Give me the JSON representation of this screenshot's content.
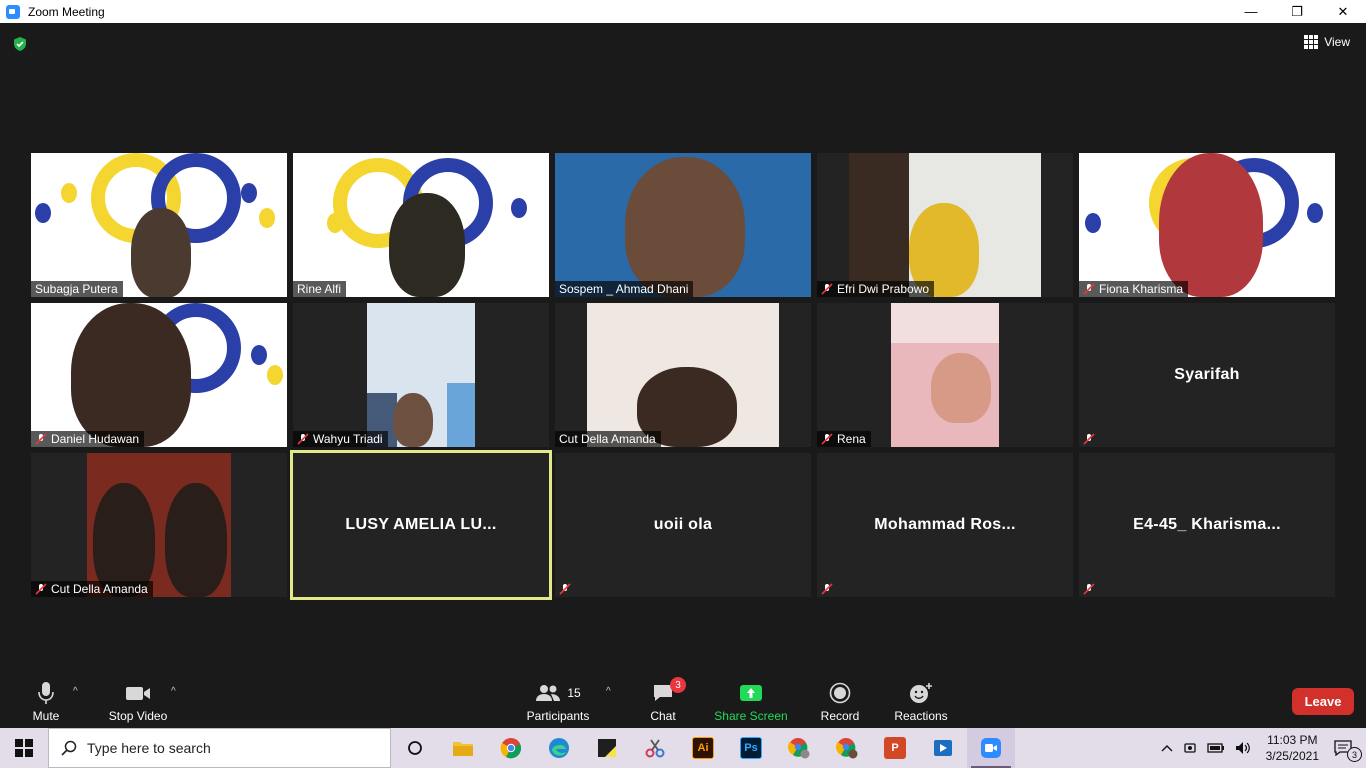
{
  "window": {
    "title": "Zoom Meeting",
    "minimize": "—",
    "restore": "❐",
    "close": "✕"
  },
  "meeting": {
    "view_label": "View"
  },
  "tiles": [
    {
      "name": "Subagja Putera",
      "muted": false
    },
    {
      "name": "Rine Alfi",
      "muted": false
    },
    {
      "name": "Sospem _ Ahmad Dhani",
      "muted": false
    },
    {
      "name": "Efri Dwi Prabowo",
      "muted": true
    },
    {
      "name": "Fiona Kharisma",
      "muted": true
    },
    {
      "name": "Daniel Hudawan",
      "muted": true
    },
    {
      "name": "Wahyu Triadi",
      "muted": true
    },
    {
      "name": "Cut Della Amanda",
      "muted": false
    },
    {
      "name": "Rena",
      "muted": true
    },
    {
      "name": "Syarifah",
      "muted": true
    },
    {
      "name": "Cut Della Amanda",
      "muted": true
    },
    {
      "name": "LUSY  AMELIA  LU...",
      "muted": false
    },
    {
      "name": "uoii ola",
      "muted": true
    },
    {
      "name": "Mohammad  Ros...",
      "muted": true
    },
    {
      "name": "E4-45_  Kharisma...",
      "muted": true
    }
  ],
  "toolbar": {
    "mute": "Mute",
    "stop_video": "Stop Video",
    "participants": "Participants",
    "participants_count": "15",
    "chat": "Chat",
    "chat_badge": "3",
    "share_screen": "Share Screen",
    "record": "Record",
    "reactions": "Reactions",
    "leave": "Leave"
  },
  "taskbar": {
    "search_placeholder": "Type here to search",
    "time": "11:03 PM",
    "date": "3/25/2021",
    "notifications": "3",
    "app_ai": "Ai",
    "app_ps": "Ps",
    "app_ppt": "P"
  },
  "colors": {
    "accent_blue": "#2d8cff",
    "active_speaker": "#e3e98a",
    "leave_red": "#d1302b",
    "share_green": "#23d959"
  }
}
